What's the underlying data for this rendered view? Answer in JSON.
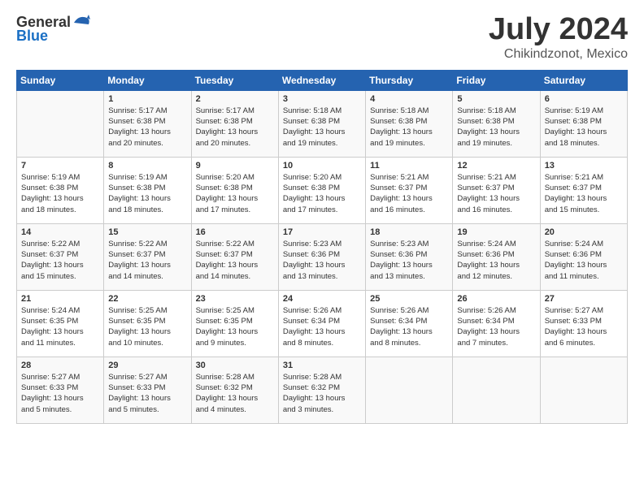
{
  "header": {
    "logo_general": "General",
    "logo_blue": "Blue",
    "month": "July 2024",
    "location": "Chikindzonot, Mexico"
  },
  "weekdays": [
    "Sunday",
    "Monday",
    "Tuesday",
    "Wednesday",
    "Thursday",
    "Friday",
    "Saturday"
  ],
  "weeks": [
    [
      {
        "day": "",
        "info": ""
      },
      {
        "day": "1",
        "info": "Sunrise: 5:17 AM\nSunset: 6:38 PM\nDaylight: 13 hours\nand 20 minutes."
      },
      {
        "day": "2",
        "info": "Sunrise: 5:17 AM\nSunset: 6:38 PM\nDaylight: 13 hours\nand 20 minutes."
      },
      {
        "day": "3",
        "info": "Sunrise: 5:18 AM\nSunset: 6:38 PM\nDaylight: 13 hours\nand 19 minutes."
      },
      {
        "day": "4",
        "info": "Sunrise: 5:18 AM\nSunset: 6:38 PM\nDaylight: 13 hours\nand 19 minutes."
      },
      {
        "day": "5",
        "info": "Sunrise: 5:18 AM\nSunset: 6:38 PM\nDaylight: 13 hours\nand 19 minutes."
      },
      {
        "day": "6",
        "info": "Sunrise: 5:19 AM\nSunset: 6:38 PM\nDaylight: 13 hours\nand 18 minutes."
      }
    ],
    [
      {
        "day": "7",
        "info": "Sunrise: 5:19 AM\nSunset: 6:38 PM\nDaylight: 13 hours\nand 18 minutes."
      },
      {
        "day": "8",
        "info": "Sunrise: 5:19 AM\nSunset: 6:38 PM\nDaylight: 13 hours\nand 18 minutes."
      },
      {
        "day": "9",
        "info": "Sunrise: 5:20 AM\nSunset: 6:38 PM\nDaylight: 13 hours\nand 17 minutes."
      },
      {
        "day": "10",
        "info": "Sunrise: 5:20 AM\nSunset: 6:38 PM\nDaylight: 13 hours\nand 17 minutes."
      },
      {
        "day": "11",
        "info": "Sunrise: 5:21 AM\nSunset: 6:37 PM\nDaylight: 13 hours\nand 16 minutes."
      },
      {
        "day": "12",
        "info": "Sunrise: 5:21 AM\nSunset: 6:37 PM\nDaylight: 13 hours\nand 16 minutes."
      },
      {
        "day": "13",
        "info": "Sunrise: 5:21 AM\nSunset: 6:37 PM\nDaylight: 13 hours\nand 15 minutes."
      }
    ],
    [
      {
        "day": "14",
        "info": "Sunrise: 5:22 AM\nSunset: 6:37 PM\nDaylight: 13 hours\nand 15 minutes."
      },
      {
        "day": "15",
        "info": "Sunrise: 5:22 AM\nSunset: 6:37 PM\nDaylight: 13 hours\nand 14 minutes."
      },
      {
        "day": "16",
        "info": "Sunrise: 5:22 AM\nSunset: 6:37 PM\nDaylight: 13 hours\nand 14 minutes."
      },
      {
        "day": "17",
        "info": "Sunrise: 5:23 AM\nSunset: 6:36 PM\nDaylight: 13 hours\nand 13 minutes."
      },
      {
        "day": "18",
        "info": "Sunrise: 5:23 AM\nSunset: 6:36 PM\nDaylight: 13 hours\nand 13 minutes."
      },
      {
        "day": "19",
        "info": "Sunrise: 5:24 AM\nSunset: 6:36 PM\nDaylight: 13 hours\nand 12 minutes."
      },
      {
        "day": "20",
        "info": "Sunrise: 5:24 AM\nSunset: 6:36 PM\nDaylight: 13 hours\nand 11 minutes."
      }
    ],
    [
      {
        "day": "21",
        "info": "Sunrise: 5:24 AM\nSunset: 6:35 PM\nDaylight: 13 hours\nand 11 minutes."
      },
      {
        "day": "22",
        "info": "Sunrise: 5:25 AM\nSunset: 6:35 PM\nDaylight: 13 hours\nand 10 minutes."
      },
      {
        "day": "23",
        "info": "Sunrise: 5:25 AM\nSunset: 6:35 PM\nDaylight: 13 hours\nand 9 minutes."
      },
      {
        "day": "24",
        "info": "Sunrise: 5:26 AM\nSunset: 6:34 PM\nDaylight: 13 hours\nand 8 minutes."
      },
      {
        "day": "25",
        "info": "Sunrise: 5:26 AM\nSunset: 6:34 PM\nDaylight: 13 hours\nand 8 minutes."
      },
      {
        "day": "26",
        "info": "Sunrise: 5:26 AM\nSunset: 6:34 PM\nDaylight: 13 hours\nand 7 minutes."
      },
      {
        "day": "27",
        "info": "Sunrise: 5:27 AM\nSunset: 6:33 PM\nDaylight: 13 hours\nand 6 minutes."
      }
    ],
    [
      {
        "day": "28",
        "info": "Sunrise: 5:27 AM\nSunset: 6:33 PM\nDaylight: 13 hours\nand 5 minutes."
      },
      {
        "day": "29",
        "info": "Sunrise: 5:27 AM\nSunset: 6:33 PM\nDaylight: 13 hours\nand 5 minutes."
      },
      {
        "day": "30",
        "info": "Sunrise: 5:28 AM\nSunset: 6:32 PM\nDaylight: 13 hours\nand 4 minutes."
      },
      {
        "day": "31",
        "info": "Sunrise: 5:28 AM\nSunset: 6:32 PM\nDaylight: 13 hours\nand 3 minutes."
      },
      {
        "day": "",
        "info": ""
      },
      {
        "day": "",
        "info": ""
      },
      {
        "day": "",
        "info": ""
      }
    ]
  ]
}
